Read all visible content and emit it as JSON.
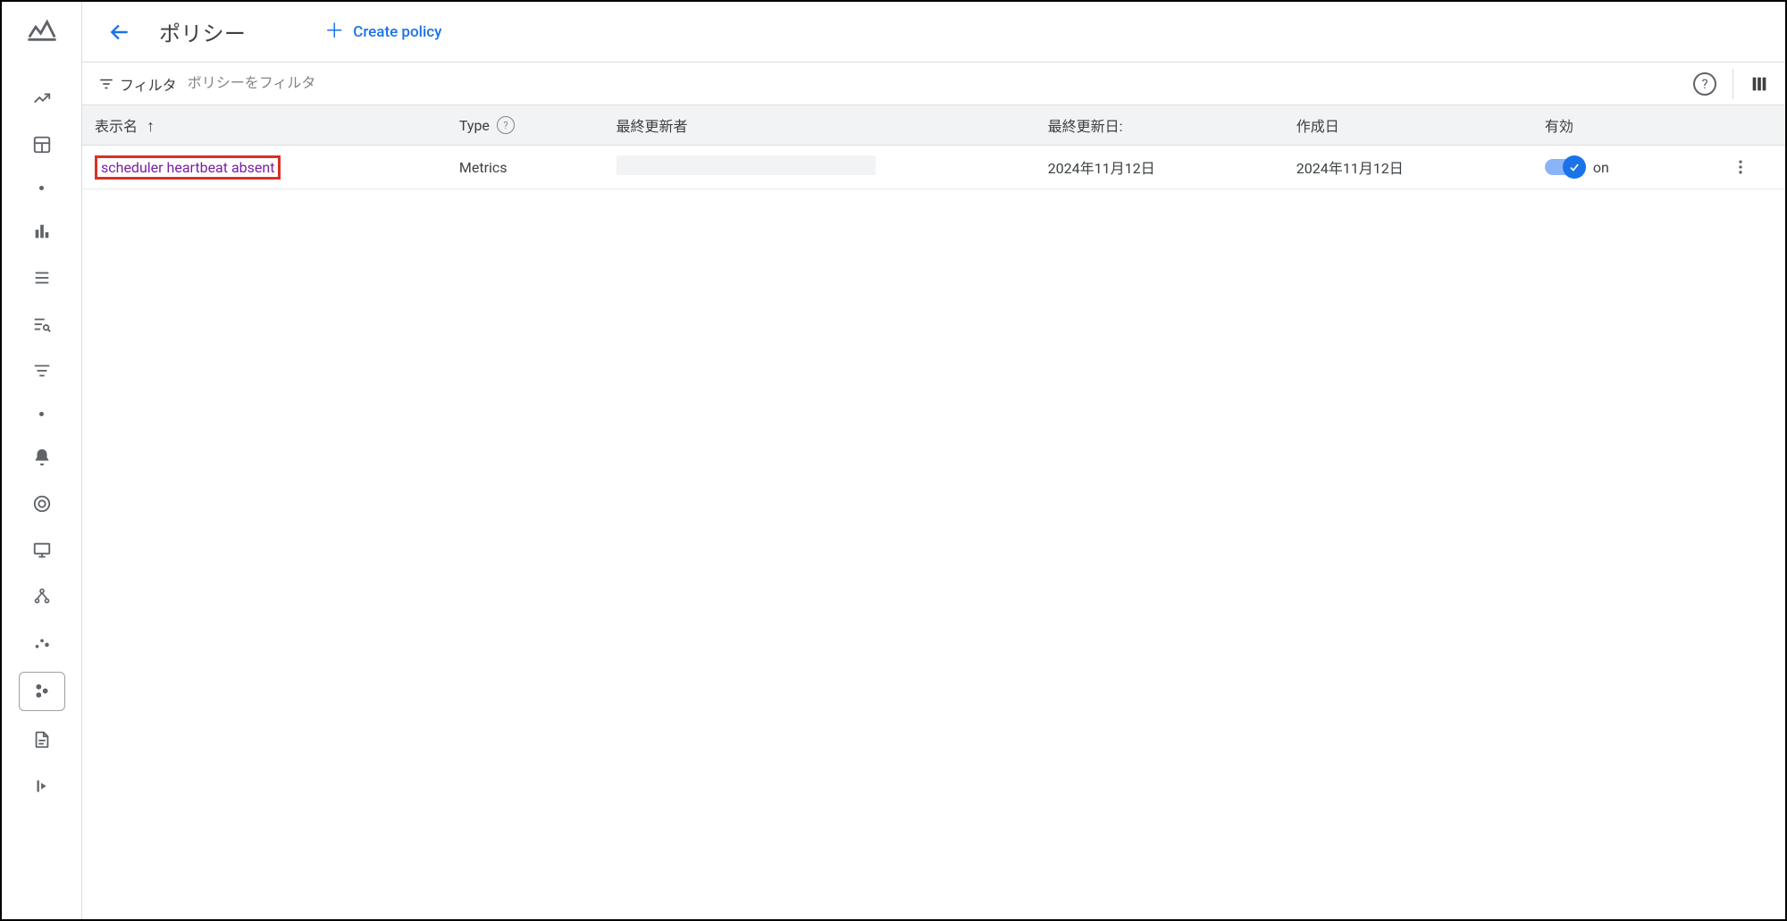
{
  "header": {
    "page_title": "ポリシー",
    "create_label": "Create policy"
  },
  "filter": {
    "chip_label": "フィルタ",
    "placeholder": "ポリシーをフィルタ"
  },
  "table": {
    "columns": {
      "name": "表示名",
      "type": "Type",
      "last_updater": "最終更新者",
      "last_updated": "最終更新日:",
      "created": "作成日",
      "enabled": "有効"
    },
    "rows": [
      {
        "name": "scheduler heartbeat absent",
        "type": "Metrics",
        "last_updated": "2024年11月12日",
        "created": "2024年11月12日",
        "enabled_label": "on"
      }
    ]
  }
}
